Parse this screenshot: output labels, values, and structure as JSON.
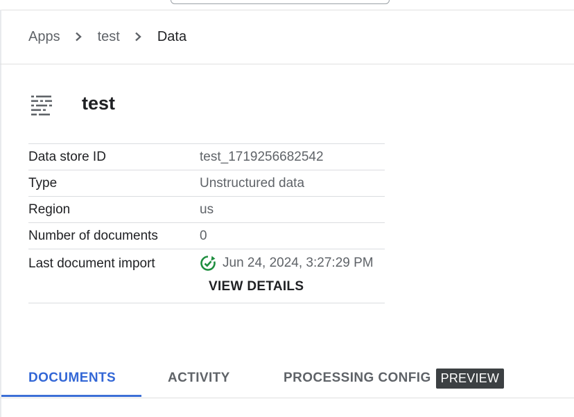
{
  "breadcrumb": {
    "items": [
      "Apps",
      "test",
      "Data"
    ]
  },
  "data_store": {
    "icon": "data-store-icon",
    "title": "test"
  },
  "details": {
    "rows": [
      {
        "label": "Data store ID",
        "value": "test_1719256682542"
      },
      {
        "label": "Type",
        "value": "Unstructured data"
      },
      {
        "label": "Region",
        "value": "us"
      },
      {
        "label": "Number of documents",
        "value": "0"
      }
    ],
    "last_import": {
      "label": "Last document import",
      "value": "Jun 24, 2024, 3:27:29 PM",
      "status_icon": "import-complete-icon",
      "status_color": "#1e8e3e",
      "action_label": "VIEW DETAILS"
    }
  },
  "tabs": {
    "items": [
      {
        "label": "DOCUMENTS",
        "active": true
      },
      {
        "label": "ACTIVITY",
        "active": false
      },
      {
        "label": "PROCESSING CONFIG",
        "active": false,
        "badge": "PREVIEW"
      }
    ],
    "accent_color": "#3367d6"
  }
}
